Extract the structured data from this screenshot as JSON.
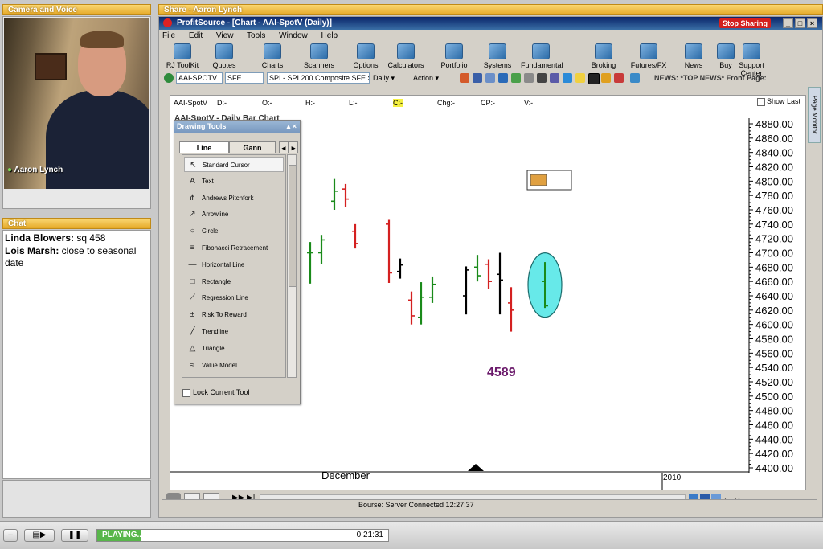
{
  "camera_panel": {
    "title": "Camera and Voice",
    "presenter": "Aaron Lynch"
  },
  "chat_panel": {
    "title": "Chat",
    "messages": [
      {
        "author": "Linda Blowers:",
        "text": " sq 458"
      },
      {
        "author": "Lois Marsh:",
        "text": " close to seasonal date"
      }
    ]
  },
  "share_panel": {
    "title": "Share - Aaron Lynch",
    "app_title": "ProfitSource - [Chart - AAI-SpotV (Daily)]",
    "stop_sharing": "Stop Sharing"
  },
  "menu": [
    "File",
    "Edit",
    "View",
    "Tools",
    "Window",
    "Help"
  ],
  "toolbar": [
    {
      "label": "RJ ToolKit",
      "icon": "toolkit-icon"
    },
    {
      "label": "Quotes",
      "icon": "quotes-icon"
    },
    {
      "label": "Charts",
      "icon": "charts-icon"
    },
    {
      "label": "Scanners",
      "icon": "scanners-icon"
    },
    {
      "label": "Options",
      "icon": "options-icon"
    },
    {
      "label": "Calculators",
      "icon": "calculators-icon"
    },
    {
      "label": "Portfolio",
      "icon": "portfolio-icon"
    },
    {
      "label": "Systems",
      "icon": "systems-icon"
    },
    {
      "label": "Fundamental",
      "icon": "fundamental-icon"
    },
    {
      "label": "Broking",
      "icon": "broking-icon"
    },
    {
      "label": "Futures/FX",
      "icon": "futures-icon"
    },
    {
      "label": "News",
      "icon": "news-icon"
    },
    {
      "label": "Buy",
      "icon": "buy-icon"
    },
    {
      "label": "Support Center",
      "icon": "support-icon"
    }
  ],
  "secondary_bar": {
    "symbol": "AAI-SPOTV",
    "exchange": "SFE",
    "description": "SPI - SPI 200 Composite.SFE Spot",
    "period": "Daily",
    "action": "Action",
    "news": "NEWS: *TOP NEWS* Front Page:"
  },
  "chart_header": {
    "symbol": "AAI-SpotV",
    "fields": [
      "D:-",
      "O:-",
      "H:-",
      "L:-",
      "C:-",
      "Chg:-",
      "CP:-",
      "V:-"
    ],
    "show_last": "Show Last",
    "subtitle": "AAI-SpotV - Daily Bar Chart"
  },
  "drawing_tools": {
    "title": "Drawing Tools",
    "tabs": [
      "Line",
      "Gann"
    ],
    "items": [
      {
        "label": "Standard Cursor",
        "icon": "cursor-icon",
        "glyph": "↖"
      },
      {
        "label": "Text",
        "icon": "text-icon",
        "glyph": "A"
      },
      {
        "label": "Andrews Pitchfork",
        "icon": "pitchfork-icon",
        "glyph": "⋔"
      },
      {
        "label": "Arrowline",
        "icon": "arrow-icon",
        "glyph": "↗"
      },
      {
        "label": "Circle",
        "icon": "circle-icon",
        "glyph": "○"
      },
      {
        "label": "Fibonacci Retracement",
        "icon": "fibonacci-icon",
        "glyph": "≡"
      },
      {
        "label": "Horizontal Line",
        "icon": "horizontal-line-icon",
        "glyph": "—"
      },
      {
        "label": "Rectangle",
        "icon": "rectangle-icon",
        "glyph": "□"
      },
      {
        "label": "Regression Line",
        "icon": "regression-icon",
        "glyph": "⟋"
      },
      {
        "label": "Risk To Reward",
        "icon": "risk-reward-icon",
        "glyph": "±"
      },
      {
        "label": "Trendline",
        "icon": "trendline-icon",
        "glyph": "╱"
      },
      {
        "label": "Triangle",
        "icon": "triangle-icon",
        "glyph": "△"
      },
      {
        "label": "Value Model",
        "icon": "value-model-icon",
        "glyph": "≈"
      }
    ],
    "lock": "Lock Current Tool"
  },
  "chart_data": {
    "type": "bar",
    "subtype": "ohlc",
    "y_range": [
      4400,
      4880
    ],
    "y_ticks": [
      "4880.00",
      "4860.00",
      "4840.00",
      "4820.00",
      "4800.00",
      "4780.00",
      "4760.00",
      "4740.00",
      "4720.00",
      "4700.00",
      "4680.00",
      "4660.00",
      "4640.00",
      "4620.00",
      "4600.00",
      "4580.00",
      "4560.00",
      "4540.00",
      "4520.00",
      "4500.00",
      "4480.00",
      "4460.00",
      "4440.00",
      "4420.00",
      "4400.00"
    ],
    "x_labels": [
      "December",
      "2010"
    ],
    "annotation": "4589",
    "bars": [
      {
        "high": 4715,
        "low": 4657,
        "open": 4700,
        "close": 4700,
        "color": "#1a8a1a"
      },
      {
        "high": 4725,
        "low": 4684,
        "open": 4700,
        "close": 4718,
        "color": "#1a8a1a"
      },
      {
        "high": 4803,
        "low": 4760,
        "open": 4772,
        "close": 4786,
        "color": "#1a8a1a"
      },
      {
        "high": 4796,
        "low": 4764,
        "open": 4789,
        "close": 4775,
        "color": "#d42020"
      },
      {
        "high": 4740,
        "low": 4706,
        "open": 4730,
        "close": 4713,
        "color": "#d42020"
      },
      {
        "high": 4746,
        "low": 4658,
        "open": 4740,
        "close": 4672,
        "color": "#d42020"
      },
      {
        "high": 4692,
        "low": 4664,
        "open": 4674,
        "close": 4683,
        "color": "#000000"
      },
      {
        "high": 4646,
        "low": 4600,
        "open": 4634,
        "close": 4612,
        "color": "#d42020"
      },
      {
        "high": 4659,
        "low": 4600,
        "open": 4610,
        "close": 4638,
        "color": "#1a8a1a"
      },
      {
        "high": 4667,
        "low": 4630,
        "open": 4638,
        "close": 4656,
        "color": "#1a8a1a"
      },
      {
        "high": 4681,
        "low": 4614,
        "open": 4640,
        "close": 4676,
        "color": "#000000"
      },
      {
        "high": 4697,
        "low": 4660,
        "open": 4680,
        "close": 4668,
        "color": "#1a8a1a"
      },
      {
        "high": 4691,
        "low": 4650,
        "open": 4684,
        "close": 4660,
        "color": "#d42020"
      },
      {
        "high": 4700,
        "low": 4614,
        "open": 4670,
        "close": 4662,
        "color": "#000000"
      },
      {
        "high": 4652,
        "low": 4590,
        "open": 4630,
        "close": 4620,
        "color": "#d42020"
      },
      {
        "high": 4687,
        "low": 4623,
        "open": 4660,
        "close": 4626,
        "color": "#1a8a1a"
      }
    ],
    "highlight_color": "#5fe8e8"
  },
  "nav_bar": {},
  "status_bar": {
    "text": "Bourse: Server Connected 12:27:37"
  },
  "page_monitor": "Page Monitor",
  "player": {
    "state": "PLAYING...",
    "time": "0:21:31",
    "progress": 0.15
  }
}
